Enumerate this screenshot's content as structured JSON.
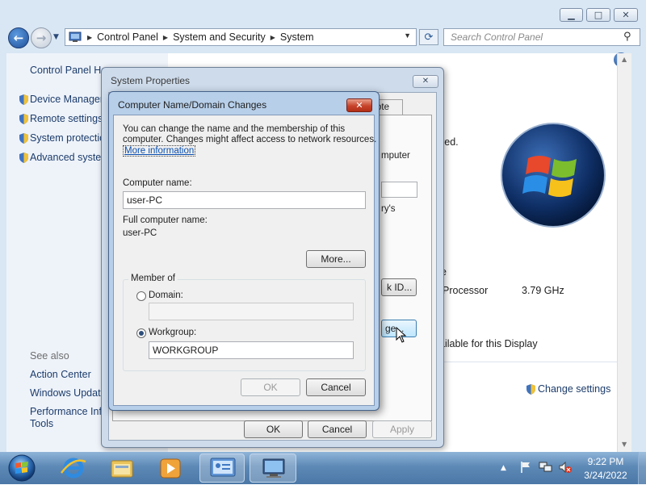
{
  "explorer": {
    "address_crumbs": [
      "Control Panel",
      "System and Security",
      "System"
    ],
    "search_placeholder": "Search Control Panel",
    "left_pane": {
      "home_link": "Control Panel Ho",
      "tasks": [
        "Device Manager",
        "Remote settings",
        "System protectio",
        "Advanced systen"
      ],
      "see_also_label": "See also",
      "see_also": [
        "Action Center",
        "Windows Update",
        "Performance Info",
        "Tools"
      ]
    },
    "main_fragments": {
      "computer": "mputer",
      "reserved": "ved.",
      "rys": "ry's",
      "e_letter": "e",
      "processor_label": "Processor",
      "processor_value": "3.79 GHz",
      "display_text": "ailable for this Display",
      "change_settings": "Change settings"
    }
  },
  "system_properties": {
    "title": "System Properties",
    "tab_fragment": "ote",
    "network_id_fragment": "k ID...",
    "change_fragment": "ge...",
    "ok": "OK",
    "cancel": "Cancel",
    "apply": "Apply"
  },
  "computer_name_dialog": {
    "title": "Computer Name/Domain Changes",
    "description_line1": "You can change the name and the membership of this",
    "description_line2": "computer. Changes might affect access to network resources.",
    "more_info_link": "More information",
    "computer_name_label": "Computer name:",
    "computer_name_value": "user-PC",
    "full_name_label": "Full computer name:",
    "full_name_value": "user-PC",
    "more_button": "More...",
    "member_of_label": "Member of",
    "domain_label": "Domain:",
    "domain_value": "",
    "workgroup_label": "Workgroup:",
    "workgroup_value": "WORKGROUP",
    "selected_membership": "Workgroup",
    "ok": "OK",
    "cancel": "Cancel"
  },
  "taskbar": {
    "time": "9:22 PM",
    "date": "3/24/2022"
  }
}
